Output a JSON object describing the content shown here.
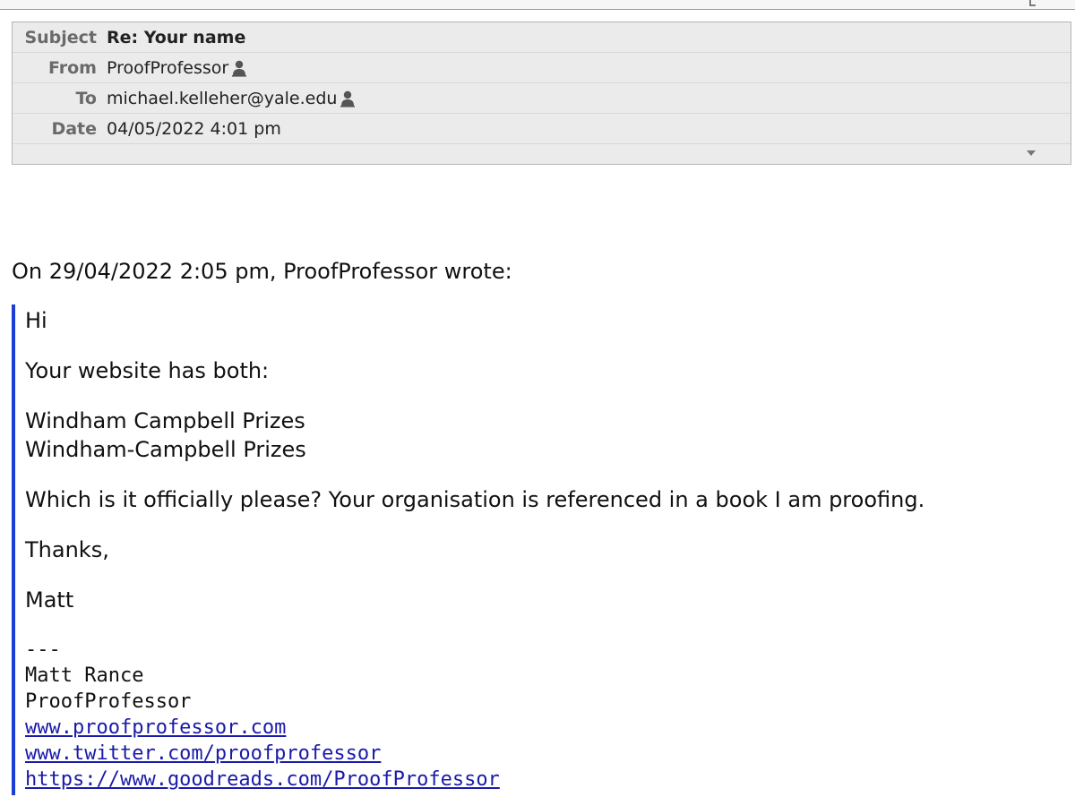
{
  "header": {
    "subject_label": "Subject",
    "subject_value": "Re: Your name",
    "from_label": "From",
    "from_value": "ProofProfessor",
    "to_label": "To",
    "to_value": "michael.kelleher@yale.edu",
    "date_label": "Date",
    "date_value": "04/05/2022 4:01 pm"
  },
  "icons": {
    "from_contact": "person-icon",
    "to_contact": "person-icon",
    "expand": "chevron-down-icon"
  },
  "body": {
    "attribution": "On 29/04/2022 2:05 pm, ProofProfessor wrote:"
  },
  "quote": {
    "greeting": "Hi",
    "line1": "Your website has both:",
    "option1": "Windham Campbell Prizes",
    "option2": "Windham-Campbell Prizes",
    "question": "Which is it officially please? Your organisation is referenced in a book I am proofing.",
    "thanks": "Thanks,",
    "name": "Matt"
  },
  "signature": {
    "separator": "---",
    "full_name": "Matt Rance",
    "company": "ProofProfessor",
    "link_website": "www.proofprofessor.com",
    "link_twitter": "www.twitter.com/proofprofessor",
    "link_goodreads": "https://www.goodreads.com/ProofProfessor"
  },
  "colors": {
    "quote_bar": "#1a3fd6",
    "link": "#1a1aaa",
    "header_bg": "#ebebeb",
    "label_gray": "#6a6a6a"
  }
}
